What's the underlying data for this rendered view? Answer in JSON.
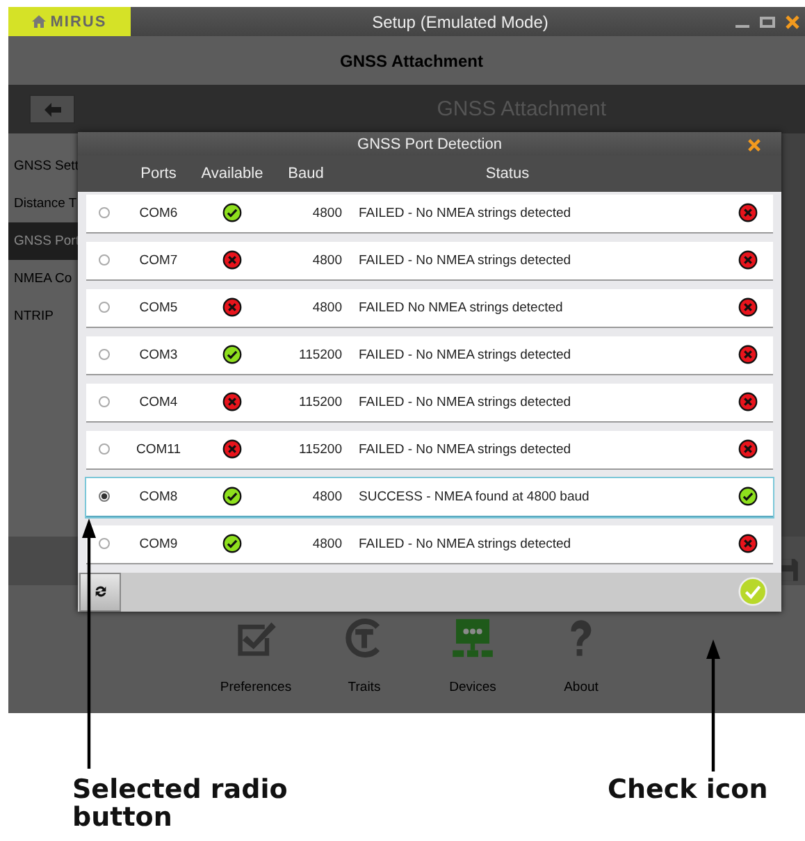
{
  "window": {
    "logo": "MIRUS",
    "title": "Setup (Emulated Mode)"
  },
  "header": {
    "title": "GNSS Attachment"
  },
  "subheader": {
    "title": "GNSS Attachment"
  },
  "sidebar": {
    "items": [
      {
        "label": "GNSS Sett",
        "selected": false
      },
      {
        "label": "Distance T",
        "selected": false
      },
      {
        "label": "GNSS Port",
        "selected": true
      },
      {
        "label": "NMEA Co",
        "selected": false
      },
      {
        "label": "NTRIP",
        "selected": false
      }
    ]
  },
  "dialog": {
    "title": "GNSS Port Detection",
    "columns": [
      "Ports",
      "Available",
      "Baud",
      "Status"
    ],
    "rows": [
      {
        "selected": false,
        "port": "COM6",
        "available": true,
        "baud": "4800",
        "status": "FAILED - No NMEA strings detected",
        "success": false
      },
      {
        "selected": false,
        "port": "COM7",
        "available": false,
        "baud": "4800",
        "status": "FAILED - No NMEA strings detected",
        "success": false
      },
      {
        "selected": false,
        "port": "COM5",
        "available": false,
        "baud": "4800",
        "status": "FAILED No NMEA strings detected",
        "success": false
      },
      {
        "selected": false,
        "port": "COM3",
        "available": true,
        "baud": "115200",
        "status": "FAILED - No NMEA strings detected",
        "success": false
      },
      {
        "selected": false,
        "port": "COM4",
        "available": false,
        "baud": "115200",
        "status": "FAILED - No NMEA strings detected",
        "success": false
      },
      {
        "selected": false,
        "port": "COM11",
        "available": false,
        "baud": "115200",
        "status": "FAILED - No NMEA strings detected",
        "success": false
      },
      {
        "selected": true,
        "port": "COM8",
        "available": true,
        "baud": "4800",
        "status": "SUCCESS - NMEA found at 4800 baud",
        "success": true
      },
      {
        "selected": false,
        "port": "COM9",
        "available": true,
        "baud": "4800",
        "status": "FAILED - No NMEA strings detected",
        "success": false
      }
    ]
  },
  "bottom_nav": {
    "items": [
      {
        "label": "Preferences",
        "kind": "preferences",
        "selected": false
      },
      {
        "label": "Traits",
        "kind": "traits",
        "selected": false
      },
      {
        "label": "Devices",
        "kind": "devices",
        "selected": true
      },
      {
        "label": "About",
        "kind": "about",
        "selected": false
      }
    ]
  },
  "annotations": [
    {
      "label": "Selected radio button"
    },
    {
      "label": "Check icon"
    }
  ]
}
